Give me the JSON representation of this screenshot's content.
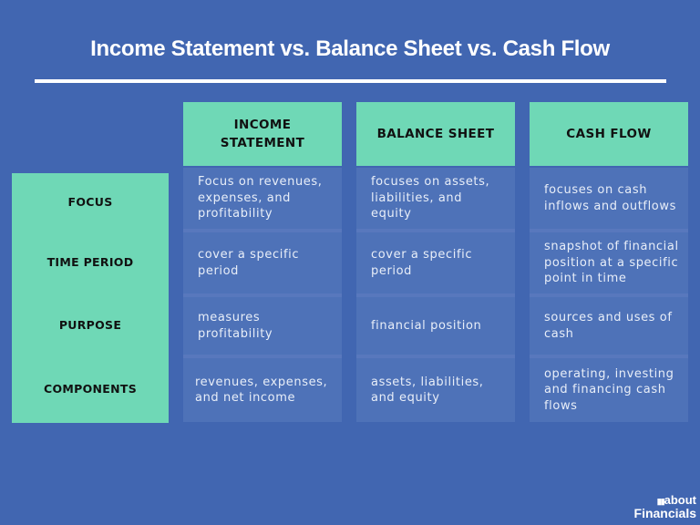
{
  "title": "Income Statement vs. Balance Sheet vs. Cash Flow",
  "row_labels": [
    "FOCUS",
    "TIME PERIOD",
    "PURPOSE",
    "COMPONENTS"
  ],
  "columns": [
    {
      "header": "INCOME\nSTATEMENT",
      "cells": [
        "Focus on revenues, expenses, and profitability",
        "cover a specific period",
        "measures profitability",
        "revenues, expenses, and net income"
      ]
    },
    {
      "header": "BALANCE SHEET",
      "cells": [
        "focuses on assets, liabilities, and equity",
        "cover a specific period",
        "financial position",
        "assets, liabilities, and equity"
      ]
    },
    {
      "header": "CASH FLOW",
      "cells": [
        "focuses on cash inflows and outflows",
        "snapshot of financial position at a specific point in time",
        "sources and uses of cash",
        "operating, investing and financing cash flows"
      ]
    }
  ],
  "logo": {
    "icon": "bar-chart-icon",
    "line1": "about",
    "line2": "Financials"
  },
  "colors": {
    "background": "#4166b1",
    "accent": "#6fd8b6",
    "cell": "#4e72b8"
  }
}
